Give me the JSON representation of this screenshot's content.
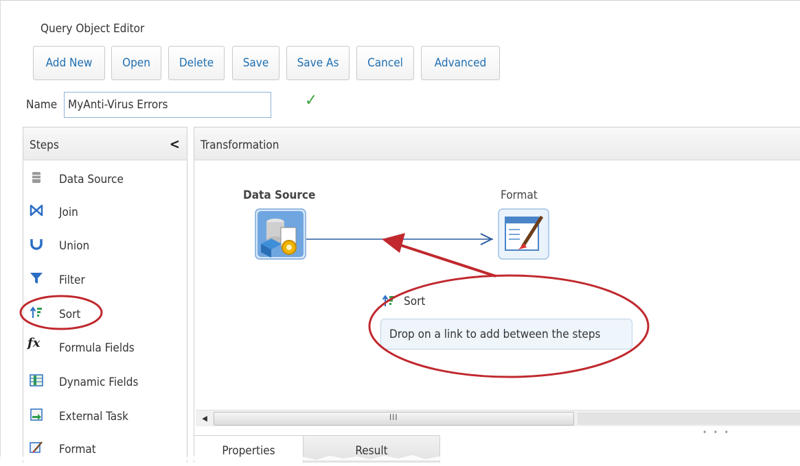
{
  "editor": {
    "title": "Query Object Editor"
  },
  "toolbar": {
    "buttons": [
      {
        "label": "Add New"
      },
      {
        "label": "Open"
      },
      {
        "label": "Delete"
      },
      {
        "label": "Save"
      },
      {
        "label": "Save As"
      },
      {
        "label": "Cancel"
      },
      {
        "label": "Advanced"
      }
    ]
  },
  "name_field": {
    "label": "Name",
    "value": "MyAnti-Virus Errors",
    "valid_icon": "checkmark-icon",
    "valid_color": "#3aa23a"
  },
  "steps": {
    "title": "Steps",
    "collapse_icon": "chevron-left-icon",
    "items": [
      {
        "label": "Data Source",
        "icon": "database-icon"
      },
      {
        "label": "Join",
        "icon": "join-icon"
      },
      {
        "label": "Union",
        "icon": "union-icon"
      },
      {
        "label": "Filter",
        "icon": "filter-icon"
      },
      {
        "label": "Sort",
        "icon": "sort-icon"
      },
      {
        "label": "Formula Fields",
        "icon": "formula-icon"
      },
      {
        "label": "Dynamic Fields",
        "icon": "dynamic-fields-icon"
      },
      {
        "label": "External Task",
        "icon": "external-task-icon"
      },
      {
        "label": "Format",
        "icon": "format-icon"
      }
    ]
  },
  "transformation": {
    "title": "Transformation",
    "nodes": [
      {
        "label": "Data Source",
        "icon": "data-source-node-icon"
      },
      {
        "label": "Format",
        "icon": "format-node-icon"
      }
    ],
    "drag_item": {
      "label": "Sort",
      "icon": "sort-icon"
    },
    "drop_hint": "Drop on a link to add between the steps",
    "annotation_color": "#c0282d",
    "link_color": "#2a5c9e"
  },
  "scrollbar": {
    "grip": "III"
  },
  "bottom_tabs": [
    {
      "label": "Properties",
      "active": true
    },
    {
      "label": "Result",
      "active": false
    }
  ]
}
